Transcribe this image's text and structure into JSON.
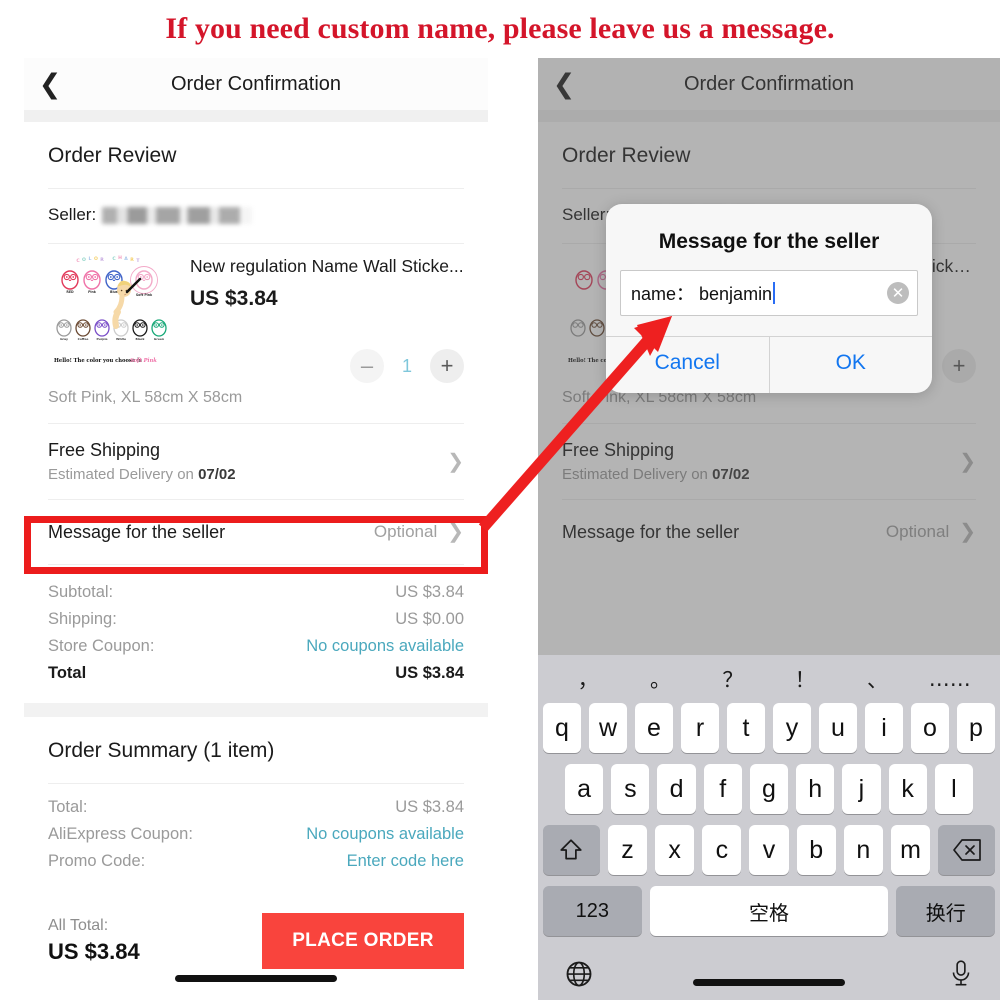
{
  "banner": {
    "text": "If you need custom name, please leave us a message."
  },
  "nav": {
    "back_icon": "chevron-left-icon",
    "title": "Order Confirmation"
  },
  "order_review": {
    "section_title": "Order Review",
    "seller_label": "Seller:",
    "product": {
      "title": "New regulation Name Wall Sticke...",
      "price": "US $3.84",
      "variant": "Soft Pink, XL 58cm X 58cm",
      "qty": "1",
      "minus_label": "–",
      "plus_label": "+",
      "image_caption": "Hello! The color you choose is Soft Pink",
      "image_heading": "COLOR CHART",
      "colors_top": [
        "RED",
        "Pink",
        "Blue",
        "Soft Pink"
      ],
      "colors_bottom": [
        "Gray",
        "Coffee",
        "Purple",
        "White",
        "Black",
        "Green"
      ]
    }
  },
  "shipping_row": {
    "title": "Free Shipping",
    "subtitle_prefix": "Estimated Delivery on ",
    "subtitle_date": "07/02",
    "chevron": "chevron-right-icon"
  },
  "message_row": {
    "title": "Message for the seller",
    "value": "Optional",
    "chevron": "chevron-right-icon"
  },
  "price_breakdown": {
    "rows": [
      {
        "key": "Subtotal:",
        "value": "US $3.84",
        "teal": false
      },
      {
        "key": "Shipping:",
        "value": "US $0.00",
        "teal": false
      },
      {
        "key": "Store Coupon:",
        "value": "No coupons available",
        "teal": true
      }
    ],
    "total": {
      "key": "Total",
      "value": "US $3.84"
    }
  },
  "order_summary": {
    "section_title": "Order Summary (1 item)",
    "rows": [
      {
        "key": "Total:",
        "value": "US $3.84",
        "teal": false
      },
      {
        "key": "AliExpress Coupon:",
        "value": "No coupons available",
        "teal": true
      },
      {
        "key": "Promo Code:",
        "value": "Enter code here",
        "teal": true
      }
    ]
  },
  "bottom_bar": {
    "all_total_label": "All Total:",
    "all_total_value": "US $3.84",
    "place_order_label": "PLACE ORDER"
  },
  "modal": {
    "title": "Message for the seller",
    "input_value": "name： benjamin",
    "clear_icon": "clear-circle-icon",
    "cancel_label": "Cancel",
    "ok_label": "OK"
  },
  "keyboard": {
    "punctuation": [
      "，",
      "。",
      "？",
      "！",
      "、",
      "……"
    ],
    "row1": [
      "q",
      "w",
      "e",
      "r",
      "t",
      "y",
      "u",
      "i",
      "o",
      "p"
    ],
    "row2": [
      "a",
      "s",
      "d",
      "f",
      "g",
      "h",
      "j",
      "k",
      "l"
    ],
    "row3": [
      "z",
      "x",
      "c",
      "v",
      "b",
      "n",
      "m"
    ],
    "shift_icon": "shift-arrow-icon",
    "backspace_icon": "backspace-icon",
    "numbers_label": "123",
    "space_label": "空格",
    "return_label": "换行",
    "globe_icon": "globe-icon",
    "mic_icon": "microphone-icon"
  },
  "annotation": {
    "highlight_color": "#ec1c1c",
    "arrow_color": "#ee2020"
  },
  "colors": {
    "banner_red": "#d4152a",
    "accent_red": "#f9443d",
    "teal": "#4aa8bd",
    "link_blue": "#1276f0"
  }
}
